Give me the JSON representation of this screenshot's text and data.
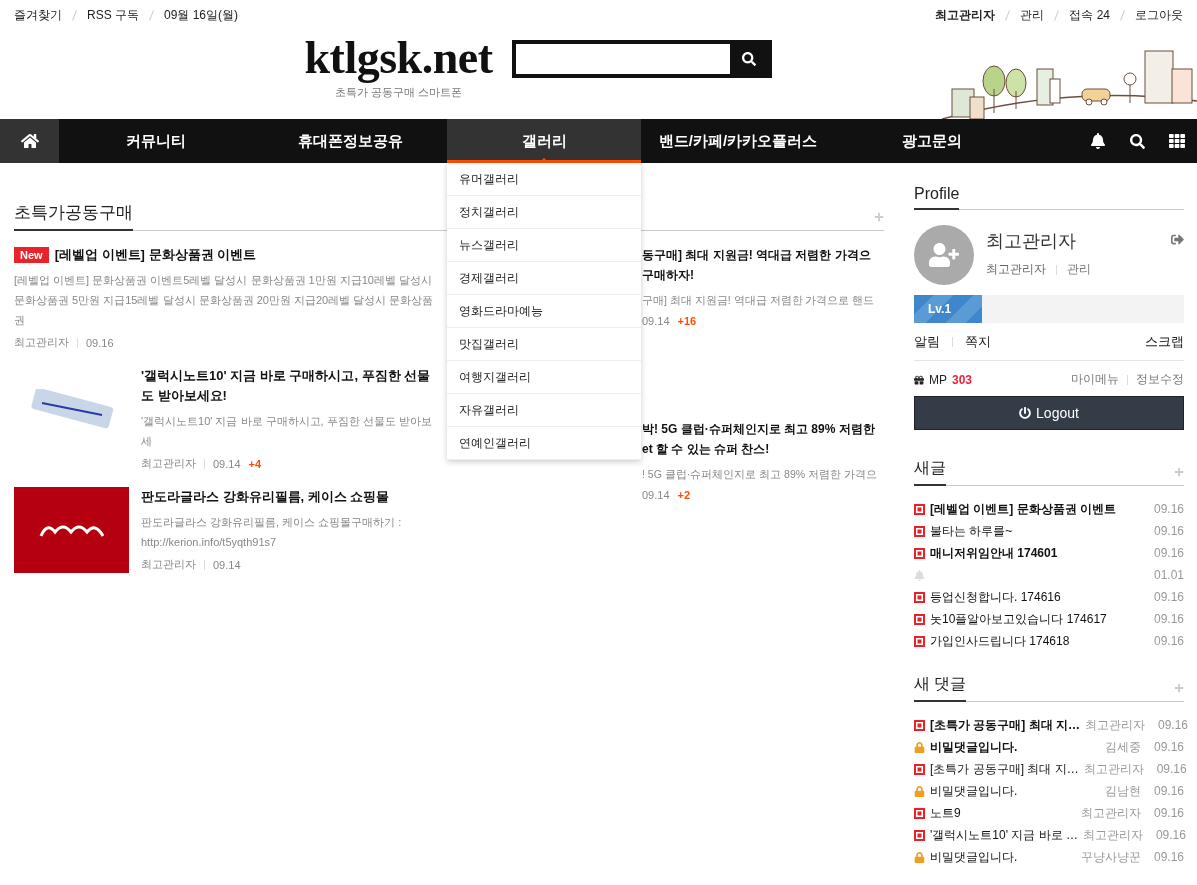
{
  "top_bar": {
    "left": [
      "즐겨찾기",
      "RSS 구독",
      "09월 16일(월)"
    ],
    "right": [
      {
        "text": "최고관리자",
        "bold": true
      },
      {
        "text": "관리",
        "bold": false
      },
      {
        "text": "접속 24",
        "bold": false
      },
      {
        "text": "로그아웃",
        "bold": false
      }
    ]
  },
  "logo": {
    "title": "ktlgsk.net",
    "tagline": "초특가 공동구매 스마트폰"
  },
  "nav": {
    "items": [
      {
        "label": "커뮤니티",
        "selected": false
      },
      {
        "label": "휴대폰정보공유",
        "selected": false
      },
      {
        "label": "갤러리",
        "selected": true
      },
      {
        "label": "밴드/카페/카카오플러스",
        "selected": false
      },
      {
        "label": "광고문의",
        "selected": false
      }
    ],
    "dropdown": [
      "유머갤러리",
      "정치갤러리",
      "뉴스갤러리",
      "경제갤러리",
      "영화드라마예능",
      "맛집갤러리",
      "여행지갤러리",
      "자유갤러리",
      "연예인갤러리"
    ]
  },
  "section": {
    "title": "초특가공동구매",
    "left_posts": [
      {
        "kind": "text",
        "badge": "New",
        "title": "[레벨업 이벤트] 문화상품권 이벤트",
        "excerpt": "[레벨업 이벤트] 문화상품권 이벤트5레벨 달성시 문화상품권 1만원 지급10레벨 달성시 문화상품권 5만원 지급15레벨 달성시 문화상품권 20만원 지급20레벨 달성시 문화상품권",
        "author": "최고관리자",
        "date": "09.16"
      },
      {
        "kind": "phone",
        "title": "'갤럭시노트10' 지금 바로 구매하시고, 푸짐한 선물도 받아보세요!",
        "excerpt": "'갤럭시노트10' 지금 바로 구매하시고, 푸짐한 선물도 받아보세",
        "author": "최고관리자",
        "date": "09.14",
        "comments": "+4"
      },
      {
        "kind": "brand",
        "title": "판도라글라스 강화유리필름, 케이스 쇼핑몰",
        "excerpt": "판도라글라스 강화유리필름, 케이스 쇼핑몰구매하기 : http://kerion.info/t5yqth91s7",
        "author": "최고관리자",
        "date": "09.14"
      }
    ],
    "right_posts": [
      {
        "title_lines": [
          "동구매] 최대 지원금! 역대급 저렴한 가격으",
          "구매하자!"
        ],
        "excerpt": "구매] 최대 지원금! 역대급 저렴한 가격으로 핸드",
        "date": "09.14",
        "comments": "+16"
      },
      {
        "title_lines": [
          "박! 5G 클럽·슈퍼체인지로 최고 89% 저렴한",
          "et 할 수 있는 슈퍼 찬스!"
        ],
        "excerpt": "! 5G 클럽·슈퍼체인지로 최고 89% 저렴한 가격으",
        "date": "09.14",
        "comments": "+2"
      }
    ]
  },
  "profile": {
    "title": "Profile",
    "name": "최고관리자",
    "role": "최고관리자",
    "admin_link": "관리",
    "level_label": "Lv.1",
    "level": 0.25,
    "links": [
      "알림",
      "쪽지"
    ],
    "scrap": "스크랩",
    "points_label": "MP",
    "points": "303",
    "menu_links": [
      "마이메뉴",
      "정보수정"
    ],
    "logout": "Logout"
  },
  "new_posts": {
    "title": "새글",
    "items": [
      {
        "kind": "new",
        "title": "[레벨업 이벤트] 문화상품권 이벤트",
        "bold": true,
        "date": "09.16"
      },
      {
        "kind": "new",
        "title": "불타는 하루를~",
        "bold": false,
        "date": "09.16"
      },
      {
        "kind": "new",
        "title": "매니저위임안내 174601",
        "bold": true,
        "date": "09.16"
      },
      {
        "kind": "notice",
        "date": "01.01"
      },
      {
        "kind": "new",
        "title": "등업신청합니다. 174616",
        "bold": false,
        "date": "09.16"
      },
      {
        "kind": "new",
        "title": "놋10플알아보고있습니다 174617",
        "bold": false,
        "date": "09.16"
      },
      {
        "kind": "new",
        "title": "가입인사드립니다 174618",
        "bold": false,
        "date": "09.16"
      }
    ]
  },
  "new_comments": {
    "title": "새 댓글",
    "items": [
      {
        "kind": "new",
        "text": "[초특가 공동구매] 최대 지…",
        "bold": true,
        "author": "최고관리자",
        "date": "09.16"
      },
      {
        "kind": "secret",
        "text": "비밀댓글입니다.",
        "bold": true,
        "author": "김세중",
        "date": "09.16"
      },
      {
        "kind": "new",
        "text": "[초특가 공동구매] 최대 지…",
        "bold": false,
        "author": "최고관리자",
        "date": "09.16"
      },
      {
        "kind": "secret",
        "text": "비밀댓글입니다.",
        "bold": false,
        "author": "김남현",
        "date": "09.16"
      },
      {
        "kind": "new",
        "text": "노트9",
        "bold": false,
        "author": "최고관리자",
        "date": "09.16"
      },
      {
        "kind": "new",
        "text": "'갤럭시노트10' 지금 바로 …",
        "bold": false,
        "author": "최고관리자",
        "date": "09.16"
      },
      {
        "kind": "secret",
        "text": "비밀댓글입니다.",
        "bold": false,
        "author": "꾸냥사냥꾼",
        "date": "09.16"
      }
    ]
  }
}
